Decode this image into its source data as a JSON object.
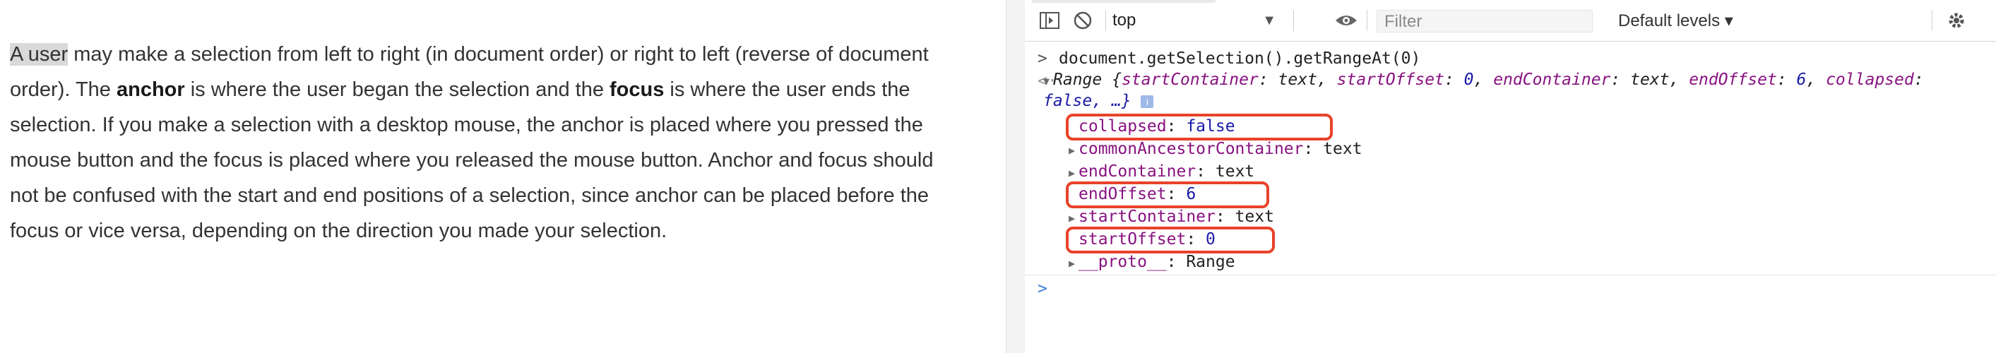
{
  "document": {
    "para_parts": [
      "A user",
      " may make a selection from left to right (in document order) or right to left (reverse of document order). The ",
      "anchor",
      " is where the user began the selection and the ",
      "focus",
      " is where the user ends the selection. If you make a selection with a desktop mouse, the anchor is placed where you pressed the mouse button and the focus is placed where you released the mouse button. Anchor and focus should not be confused with the start and end positions of a selection, since anchor can be placed before the focus or vice versa, depending on the direction you made your selection."
    ]
  },
  "devtools": {
    "toolbar": {
      "context": "top",
      "filter_placeholder": "Filter",
      "levels": "Default levels ▾",
      "icons": [
        "sidebar-toggle-icon",
        "clear-console-icon",
        "dropdown-arrow-icon",
        "eye-icon",
        "gear-icon"
      ]
    },
    "console": {
      "input": "document.getSelection().getRangeAt(0)",
      "summary": {
        "type": "Range",
        "open": " {",
        "k1": "startContainer",
        "v1": "text",
        "k2": "startOffset",
        "v2": "0",
        "k3": "endContainer",
        "v3": "text",
        "k4": "endOffset",
        "v4": "6",
        "k5": "collapsed",
        "v5": "false, …}"
      },
      "props": [
        {
          "key": "collapsed",
          "value": "false",
          "expandable": false,
          "vtype": "num"
        },
        {
          "key": "commonAncestorContainer",
          "value": "text",
          "expandable": true,
          "vtype": "str"
        },
        {
          "key": "endContainer",
          "value": "text",
          "expandable": true,
          "vtype": "str"
        },
        {
          "key": "endOffset",
          "value": "6",
          "expandable": false,
          "vtype": "num"
        },
        {
          "key": "startContainer",
          "value": "text",
          "expandable": true,
          "vtype": "str"
        },
        {
          "key": "startOffset",
          "value": "0",
          "expandable": false,
          "vtype": "num"
        },
        {
          "key": "__proto__",
          "value": "Range",
          "expandable": true,
          "vtype": "str"
        }
      ],
      "highlighted": [
        "collapsed",
        "endOffset",
        "startOffset"
      ]
    },
    "colors": {
      "highlight": "#e8432a",
      "key": "#881280",
      "number": "#1a1aa6"
    }
  }
}
